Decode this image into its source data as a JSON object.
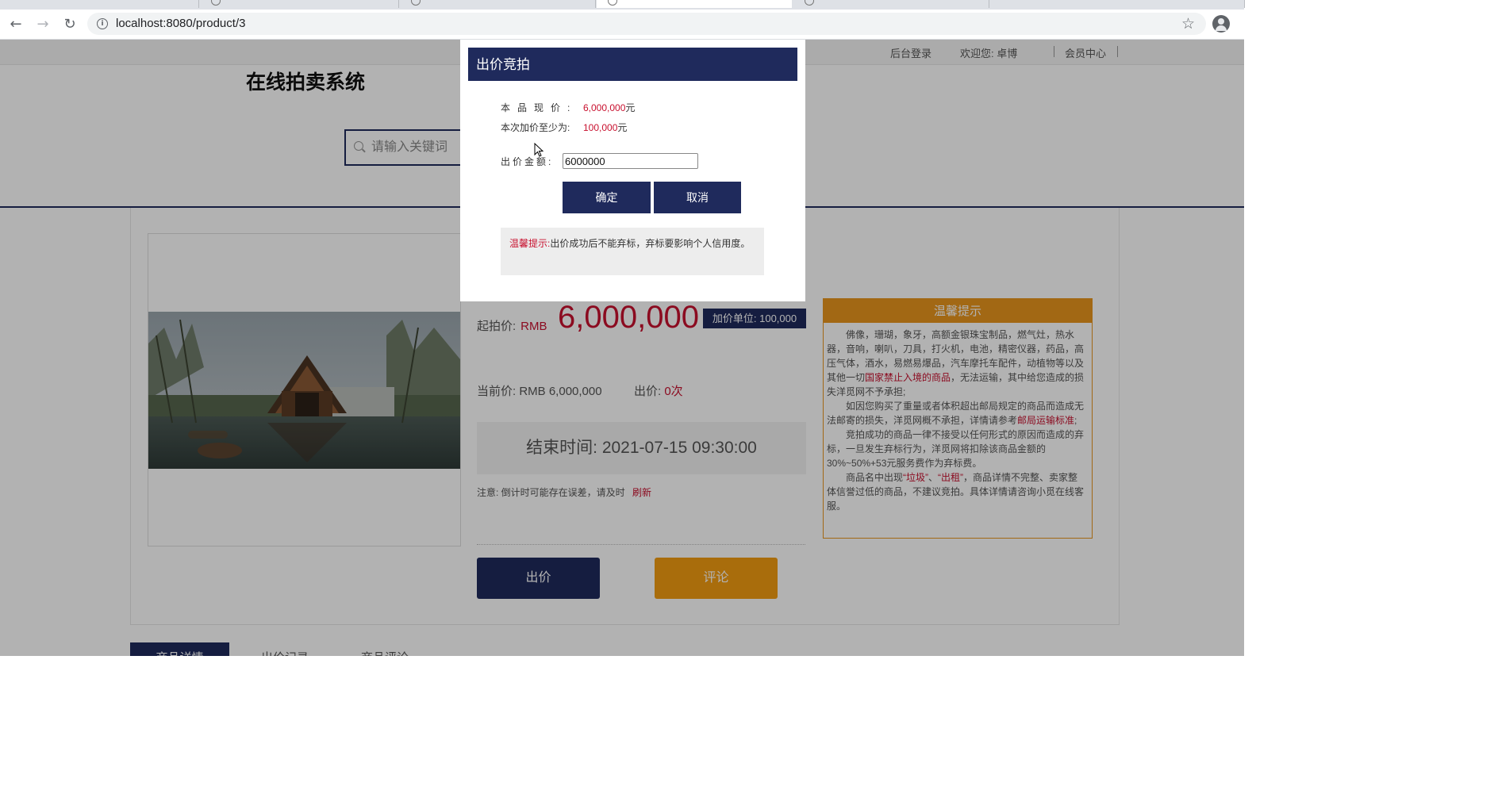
{
  "browser": {
    "url": "localhost:8080/product/3"
  },
  "topbar": {
    "admin_login": "后台登录",
    "welcome": "欢迎您: 卓博",
    "member_center": "会员中心"
  },
  "site": {
    "title": "在线拍卖系统",
    "search_placeholder": "请输入关键词"
  },
  "product": {
    "start_price_label": "起拍价:",
    "currency": "RMB",
    "start_price": "6,000,000",
    "increment_badge": "加价单位: 100,000",
    "current_price_label": "当前价: ",
    "current_price": "RMB 6,000,000",
    "bid_count_label": "出价: ",
    "bid_count": "0次",
    "end_time": "结束时间: 2021-07-15 09:30:00",
    "note": "注意: 倒计时可能存在误差，请及时",
    "refresh": "刷新",
    "bid_button": "出价",
    "comment_button": "评论"
  },
  "tips": {
    "title": "温馨提示",
    "p1_a": "佛像，珊瑚，象牙，高额金银珠宝制品，燃气灶，热水器，音响，喇叭，刀具，打火机，电池，精密仪器，药品，高压气体，酒水，易燃易爆品，汽车摩托车配件，动植物等以及其他一切",
    "p1_link": "国家禁止入境的商品",
    "p1_b": "，无法运输，其中给您造成的损失洋觅网不予承担;",
    "p2_a": "如因您购买了重量或者体积超出邮局规定的商品而造成无法邮寄的损失，洋觅网概不承担，详情请参考",
    "p2_link": "邮局运输标准",
    "p2_b": ";",
    "p3": "竞拍成功的商品一律不接受以任何形式的原因而造成的弃标，一旦发生弃标行为，洋觅网将扣除该商品金额的30%~50%+53元服务费作为弃标费。",
    "p4_a": "商品名中出现",
    "p4_q1": "“垃圾”",
    "p4_sep": "、",
    "p4_q2": "“出租”",
    "p4_b": "，商品详情不完整、卖家整体信誉过低的商品，不建议竞拍。具体详情请咨询小觅在线客服。"
  },
  "bottom_tabs": [
    "商品详情",
    "出价记录",
    "商品评论"
  ],
  "dialog": {
    "title": "出价竞拍",
    "current_price_label": "本品现价:",
    "current_price_value": "6,000,000",
    "yuan": "元",
    "min_increment_label": "本次加价至少为:",
    "min_increment_value": "100,000",
    "amount_label": "出价金额:",
    "amount_value": "6000000",
    "ok_button": "确定",
    "cancel_button": "取消",
    "tip_label": "温馨提示:",
    "tip_text": "出价成功后不能弃标，弃标要影响个人信用度。"
  },
  "colors": {
    "navy": "#1f2a5c",
    "orange": "#f39c12",
    "red": "#c8102e"
  }
}
